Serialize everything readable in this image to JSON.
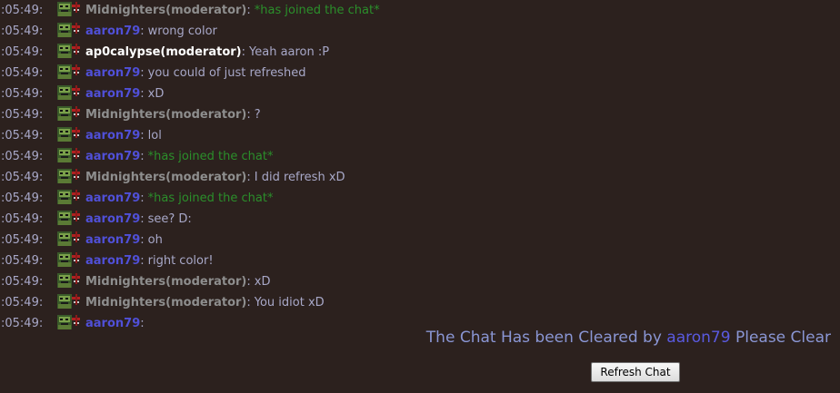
{
  "colors": {
    "background": "#2c211e",
    "timestamp": "#a8a8c8",
    "moderator_gray": "#8e8e8e",
    "moderator_white": "#ffffff",
    "user_blue": "#5050d8",
    "join_green": "#2b8f2b",
    "notice_text": "#8a96d4",
    "notice_user": "#5a5ae0"
  },
  "avatar_icon": "zombie-avatar-icon",
  "messages": [
    {
      "time": ":05:49:",
      "user": "Midnighters(moderator)",
      "user_color": "#8e8e8e",
      "text": "*has joined the chat*",
      "kind": "join"
    },
    {
      "time": ":05:49:",
      "user": "aaron79",
      "user_color": "#5050d8",
      "text": "wrong color",
      "kind": "normal"
    },
    {
      "time": ":05:49:",
      "user": "ap0calypse(moderator)",
      "user_color": "#ffffff",
      "text": "Yeah aaron :P",
      "kind": "normal"
    },
    {
      "time": ":05:49:",
      "user": "aaron79",
      "user_color": "#5050d8",
      "text": "you could of just refreshed",
      "kind": "normal"
    },
    {
      "time": ":05:49:",
      "user": "aaron79",
      "user_color": "#5050d8",
      "text": "xD",
      "kind": "normal"
    },
    {
      "time": ":05:49:",
      "user": "Midnighters(moderator)",
      "user_color": "#8e8e8e",
      "text": "?",
      "kind": "normal"
    },
    {
      "time": ":05:49:",
      "user": "aaron79",
      "user_color": "#5050d8",
      "text": "lol",
      "kind": "normal"
    },
    {
      "time": ":05:49:",
      "user": "aaron79",
      "user_color": "#5050d8",
      "text": "*has joined the chat*",
      "kind": "join"
    },
    {
      "time": ":05:49:",
      "user": "Midnighters(moderator)",
      "user_color": "#8e8e8e",
      "text": "I did refresh xD",
      "kind": "normal"
    },
    {
      "time": ":05:49:",
      "user": "aaron79",
      "user_color": "#5050d8",
      "text": "*has joined the chat*",
      "kind": "join"
    },
    {
      "time": ":05:49:",
      "user": "aaron79",
      "user_color": "#5050d8",
      "text": "see? D:",
      "kind": "normal"
    },
    {
      "time": ":05:49:",
      "user": "aaron79",
      "user_color": "#5050d8",
      "text": "oh",
      "kind": "normal"
    },
    {
      "time": ":05:49:",
      "user": "aaron79",
      "user_color": "#5050d8",
      "text": "right color!",
      "kind": "normal"
    },
    {
      "time": ":05:49:",
      "user": "Midnighters(moderator)",
      "user_color": "#8e8e8e",
      "text": "xD",
      "kind": "normal"
    },
    {
      "time": ":05:49:",
      "user": "Midnighters(moderator)",
      "user_color": "#8e8e8e",
      "text": "You idiot xD",
      "kind": "normal"
    },
    {
      "time": ":05:49:",
      "user": "aaron79",
      "user_color": "#5050d8",
      "text": "",
      "kind": "normal"
    }
  ],
  "notice": {
    "prefix": "The Chat Has been Cleared by",
    "user": "aaron79",
    "suffix": "Please Clear"
  },
  "refresh_button": {
    "label": "Refresh Chat"
  }
}
